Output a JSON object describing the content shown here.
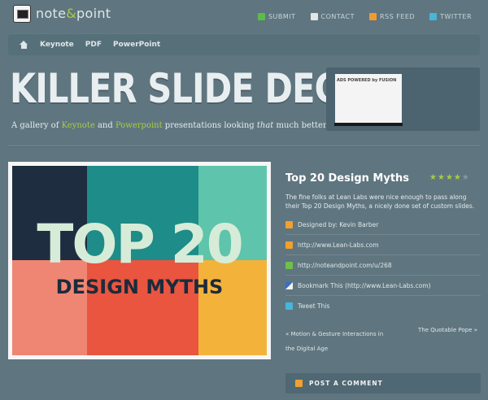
{
  "brand": {
    "name_part1": "note",
    "name_amp": "&",
    "name_part2": "point"
  },
  "top_links": [
    {
      "label": "SUBMIT",
      "icon": "submit-icon",
      "color": "#5dbb4a"
    },
    {
      "label": "CONTACT",
      "icon": "mail-icon",
      "color": "#e5e5e5"
    },
    {
      "label": "RSS FEED",
      "icon": "rss-icon",
      "color": "#f29a2e"
    },
    {
      "label": "TWITTER",
      "icon": "twitter-icon",
      "color": "#47b6d9"
    }
  ],
  "nav": {
    "items": [
      "Keynote",
      "PDF",
      "PowerPoint"
    ]
  },
  "hero": {
    "headline": "KILLER SLIDE DECKS.",
    "tagline": {
      "pre": "A gallery of ",
      "keynote": "Keynote",
      "and": " and ",
      "powerpoint": "Powerpoint",
      "mid": " presentations looking ",
      "that": "that",
      "post": " much better."
    }
  },
  "ad": {
    "text": "ADS POWERED by FUSION"
  },
  "slide": {
    "line1": "TOP 20",
    "line2": "DESIGN MYTHS"
  },
  "post": {
    "title": "Top 20 Design Myths",
    "rating": 4,
    "rating_max": 5,
    "description": "The fine folks at Lean Labs were nice enough to pass along their Top 20 Design Myths, a nicely done set of custom slides.",
    "meta": [
      {
        "icon": "designer-icon",
        "color": "#f0a030",
        "text": "Designed by: Kevin Barber"
      },
      {
        "icon": "home-link-icon",
        "color": "#f0a030",
        "text": "http://www.Lean-Labs.com"
      },
      {
        "icon": "download-icon",
        "color": "#6fbf4a",
        "text": "http://noteandpoint.com/u/268"
      },
      {
        "icon": "bookmark-icon",
        "color": "#3a6ec4",
        "text": "Bookmark This (http://www.Lean-Labs.com)"
      },
      {
        "icon": "tweet-icon",
        "color": "#47b6d9",
        "text": "Tweet This"
      }
    ],
    "prev": "« Motion & Gesture Interactions in the Digital Age",
    "next": "The Quotable Pope »",
    "comment_label": "POST A COMMENT"
  },
  "colors": {
    "accent": "#a6cc45",
    "background": "#5f7680"
  }
}
